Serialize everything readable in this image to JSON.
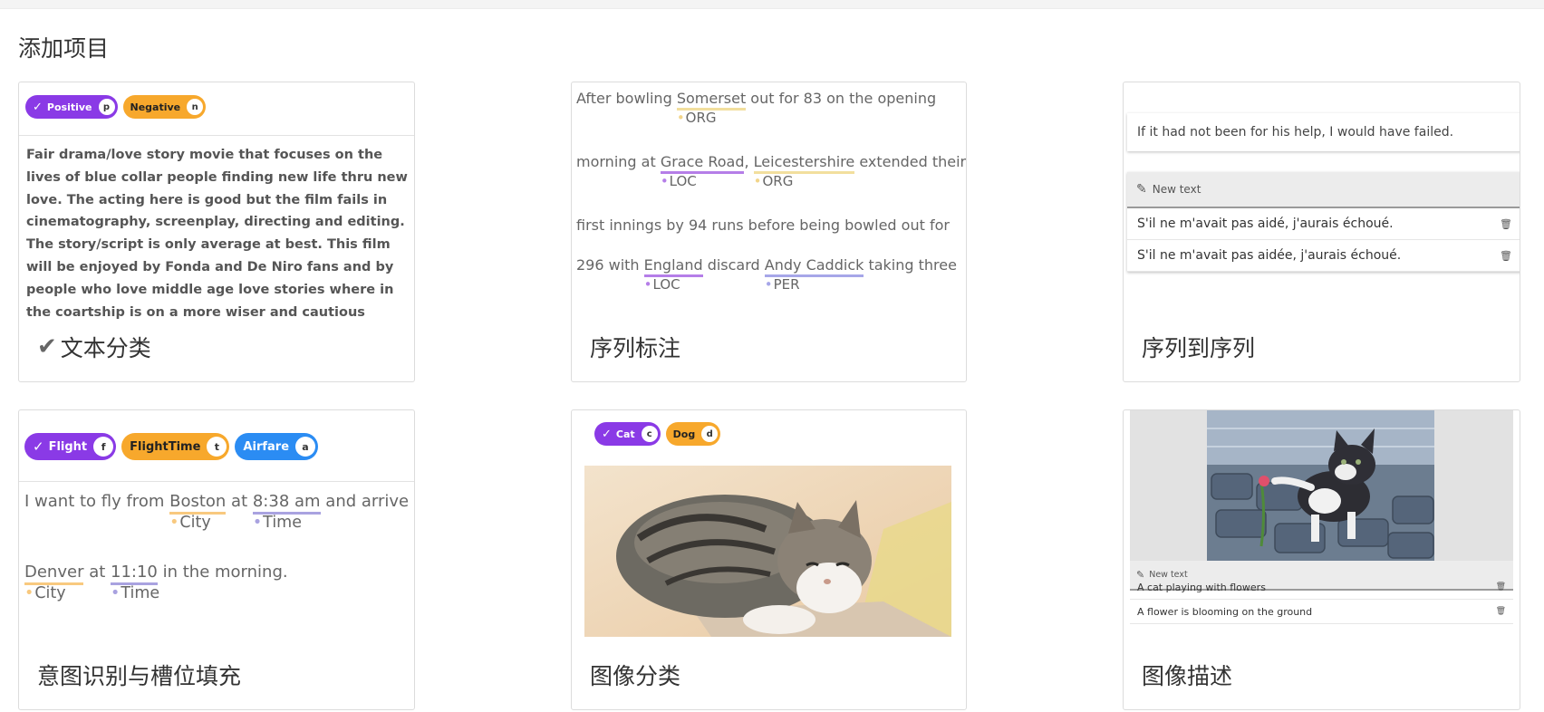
{
  "page": {
    "title": "添加项目"
  },
  "cards": {
    "text_classification": {
      "title": "文本分类",
      "labels": [
        {
          "text": "Positive",
          "key": "p",
          "color": "#8a3ae6",
          "selected": true
        },
        {
          "text": "Negative",
          "key": "n",
          "color": "#f7a82c",
          "selected": false
        }
      ],
      "text": "Fair drama/love story movie that focuses on the lives of blue collar people finding new life thru new love. The acting here is good but the film fails in cinematography, screenplay, directing and editing. The story/script is only average at best. This film will be enjoyed by Fonda and De Niro fans and by people who love middle age love stories where in the coartship is on a more wiser and cautious"
    },
    "sequence_labeling": {
      "title": "序列标注",
      "t1": "After bowling ",
      "e1": "Somerset",
      "l1": "ORG",
      "t2": " out for 83 on the opening",
      "t3": "morning at ",
      "e2": "Grace Road",
      "l2": "LOC",
      "t4": ", ",
      "e3": "Leicestershire",
      "l3": "ORG",
      "t5": " extended their",
      "t6": "first innings by 94 runs before being bowled out for",
      "t7": "296 with ",
      "e4": "England",
      "l4": "LOC",
      "t8": " discard ",
      "e5": "Andy Caddick",
      "l5": "PER",
      "t9": " taking three"
    },
    "seq2seq": {
      "title": "序列到序列",
      "source": "If it had not been for his help, I would have failed.",
      "new_text_label": "New text",
      "outputs": [
        "S'il ne m'avait pas aidé, j'aurais échoué.",
        "S'il ne m'avait pas aidée, j'aurais échoué."
      ]
    },
    "intent_detection": {
      "title": "意图识别与槽位填充",
      "labels": [
        {
          "text": "Flight",
          "key": "f",
          "color": "#8a3ae6",
          "selected": true
        },
        {
          "text": "FlightTime",
          "key": "t",
          "color": "#f7a82c",
          "selected": false
        },
        {
          "text": "Airfare",
          "key": "a",
          "color": "#2b8cf3",
          "selected": false
        }
      ],
      "t1": "I want to fly from ",
      "e1": "Boston",
      "l1": "City",
      "t2": " at ",
      "e2": "8:38 am",
      "l2": "Time",
      "t3": " and arrive in",
      "e3": "Denver",
      "l3": "City",
      "t4": " at ",
      "e4": "11:10",
      "l4": "Time",
      "t5": " in the morning."
    },
    "image_classification": {
      "title": "图像分类",
      "labels": [
        {
          "text": "Cat",
          "key": "c",
          "color": "#8a3ae6",
          "selected": true
        },
        {
          "text": "Dog",
          "key": "d",
          "color": "#f7a82c",
          "selected": false
        }
      ]
    },
    "image_captioning": {
      "title": "图像描述",
      "new_text_label": "New text",
      "captions": [
        "A cat playing with flowers",
        "A flower is blooming on the ground"
      ]
    }
  },
  "icons": {
    "check": "check-icon",
    "pencil": "pencil-icon",
    "trash": "trash-icon"
  }
}
